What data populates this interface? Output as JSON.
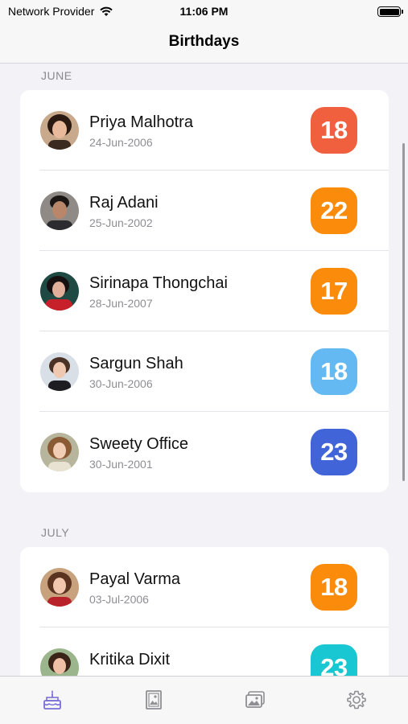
{
  "status_bar": {
    "carrier": "Network Provider",
    "time": "11:06 PM"
  },
  "nav": {
    "title": "Birthdays"
  },
  "sections": [
    {
      "header": "JUNE",
      "people": [
        {
          "name": "Priya Malhotra",
          "date": "24-Jun-2006",
          "age": "18",
          "color": "#f0603e"
        },
        {
          "name": "Raj Adani",
          "date": "25-Jun-2002",
          "age": "22",
          "color": "#fb8b0a"
        },
        {
          "name": "Sirinapa Thongchai",
          "date": "28-Jun-2007",
          "age": "17",
          "color": "#fb8b0a"
        },
        {
          "name": "Sargun Shah",
          "date": "30-Jun-2006",
          "age": "18",
          "color": "#64b9f2"
        },
        {
          "name": "Sweety Office",
          "date": "30-Jun-2001",
          "age": "23",
          "color": "#4165d8"
        }
      ]
    },
    {
      "header": "JULY",
      "people": [
        {
          "name": "Payal Varma",
          "date": "03-Jul-2006",
          "age": "18",
          "color": "#fb8b0a"
        },
        {
          "name": "Kritika Dixit",
          "date": "",
          "age": "23",
          "color": "#18c7d2"
        }
      ]
    }
  ],
  "tabs": [
    {
      "icon": "birthday-cake-icon",
      "active": true
    },
    {
      "icon": "photo-frame-icon",
      "active": false
    },
    {
      "icon": "photo-gallery-icon",
      "active": false
    },
    {
      "icon": "gear-icon",
      "active": false
    }
  ],
  "colors": {
    "accent": "#7b6fd8",
    "inactive_tab": "#8e8e93"
  }
}
